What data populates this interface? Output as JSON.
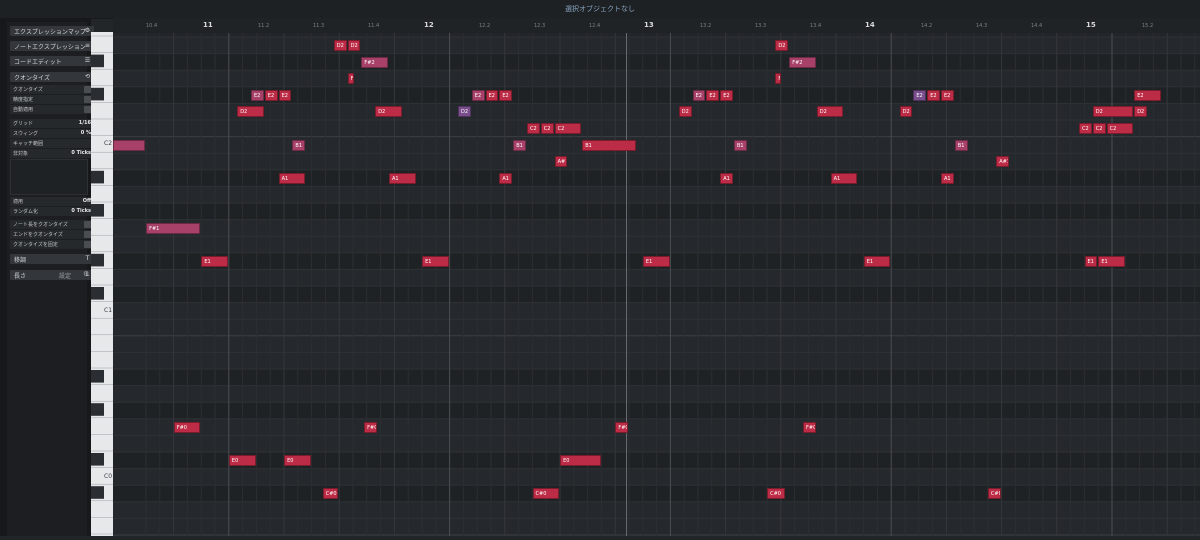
{
  "topbar": {
    "title": "選択オブジェクトなし"
  },
  "inspector": {
    "sections": [
      {
        "label": "エクスプレッションマップ"
      },
      {
        "label": "ノートエクスプレッション"
      },
      {
        "label": "コードエディット"
      },
      {
        "label": "クオンタイズ"
      }
    ],
    "quantize_rows": [
      {
        "label": "クオンタイズ",
        "value": ""
      },
      {
        "label": "精度指定",
        "value": ""
      },
      {
        "label": "自動適用",
        "value": ""
      },
      {
        "label": "グリッド",
        "value": "1/16"
      },
      {
        "label": "スウィング",
        "value": "0 %"
      },
      {
        "label": "キャッチ範囲",
        "value": ""
      },
      {
        "label": "非対象",
        "value": "0 Ticks"
      },
      {
        "label": "適用",
        "value": "Off"
      },
      {
        "label": "ランダム化",
        "value": "0 Ticks"
      },
      {
        "label": "ノート長をクオンタイズ",
        "value": ""
      },
      {
        "label": "エンドをクオンタイズ",
        "value": ""
      },
      {
        "label": "クオンタイズを固定",
        "value": ""
      }
    ],
    "bottom_sections": [
      {
        "label": "移調",
        "icon": "T"
      },
      {
        "label": "長さ",
        "icon": "L"
      }
    ],
    "settings_label": "設定"
  },
  "keyboard": {
    "labels": [
      "C2",
      "C1",
      "C0"
    ]
  },
  "ruler": {
    "bars": [
      "11",
      "12",
      "13",
      "14",
      "15"
    ],
    "beats": [
      "10.4",
      "11.2",
      "11.3",
      "11.4",
      "12.2",
      "12.3",
      "12.4",
      "13.2",
      "13.3",
      "13.4",
      "14.2",
      "14.3",
      "14.4",
      "15.2"
    ]
  },
  "colors": {
    "red": "#bd2c46",
    "magenta": "#a8416a",
    "purple": "#7a4e8c"
  },
  "notes": [
    {
      "label": "D2",
      "row": 0,
      "col": 16
    },
    {
      "label": "D2",
      "row": 0,
      "col": 17
    },
    {
      "label": "D2",
      "row": 0,
      "col": 48
    },
    {
      "label": "F#2",
      "row": 1,
      "col": 18,
      "len": 2,
      "color": "magenta"
    },
    {
      "label": "F#2",
      "row": 1,
      "col": 49,
      "len": 2,
      "color": "magenta"
    },
    {
      "label": "F2",
      "row": 2,
      "col": 17,
      "len": 0.5
    },
    {
      "label": "F2",
      "row": 2,
      "col": 48,
      "len": 0.5
    },
    {
      "label": "E2",
      "row": 3,
      "col": 10,
      "len": 1,
      "color": "magenta"
    },
    {
      "label": "E2",
      "row": 3,
      "col": 11
    },
    {
      "label": "E2",
      "row": 3,
      "col": 12
    },
    {
      "label": "E2",
      "row": 3,
      "col": 26,
      "len": 1,
      "color": "magenta"
    },
    {
      "label": "E2",
      "row": 3,
      "col": 27
    },
    {
      "label": "E2",
      "row": 3,
      "col": 28
    },
    {
      "label": "E2",
      "row": 3,
      "col": 42,
      "len": 1,
      "color": "magenta"
    },
    {
      "label": "E2",
      "row": 3,
      "col": 43
    },
    {
      "label": "E2",
      "row": 3,
      "col": 44
    },
    {
      "label": "E2",
      "row": 3,
      "col": 58,
      "len": 1,
      "color": "purple"
    },
    {
      "label": "E2",
      "row": 3,
      "col": 59
    },
    {
      "label": "E2",
      "row": 3,
      "col": 60
    },
    {
      "label": "E2",
      "row": 3,
      "col": 74,
      "len": 2
    },
    {
      "label": "D2",
      "row": 4,
      "col": 9,
      "len": 2
    },
    {
      "label": "D2",
      "row": 4,
      "col": 19,
      "len": 2
    },
    {
      "label": "D2",
      "row": 4,
      "col": 25,
      "len": 1,
      "color": "purple"
    },
    {
      "label": "D2",
      "row": 4,
      "col": 41
    },
    {
      "label": "D2",
      "row": 4,
      "col": 51,
      "len": 2
    },
    {
      "label": "D2",
      "row": 4,
      "col": 57
    },
    {
      "label": "D2",
      "row": 4,
      "col": 71,
      "len": 3
    },
    {
      "label": "D2",
      "row": 4,
      "col": 74
    },
    {
      "label": "D2",
      "row": 4,
      "col": 79
    },
    {
      "label": "D2",
      "row": 4,
      "col": 80
    },
    {
      "label": "D2",
      "row": 4,
      "col": 81,
      "len": 2
    },
    {
      "label": "C2",
      "row": 5,
      "col": 30
    },
    {
      "label": "C2",
      "row": 5,
      "col": 31
    },
    {
      "label": "C2",
      "row": 5,
      "col": 32,
      "len": 2
    },
    {
      "label": "C2",
      "row": 5,
      "col": 70
    },
    {
      "label": "C2",
      "row": 5,
      "col": 71
    },
    {
      "label": "C2",
      "row": 5,
      "col": 72,
      "len": 2
    },
    {
      "label": "",
      "row": 6,
      "col": 0,
      "len": 2.4,
      "color": "magenta"
    },
    {
      "label": "B1",
      "row": 6,
      "col": 13,
      "len": 1,
      "color": "magenta"
    },
    {
      "label": "B1",
      "row": 6,
      "col": 29,
      "len": 1,
      "color": "magenta"
    },
    {
      "label": "B1",
      "row": 6,
      "col": 34,
      "len": 4
    },
    {
      "label": "B1",
      "row": 6,
      "col": 45,
      "len": 1,
      "color": "magenta"
    },
    {
      "label": "B1",
      "row": 6,
      "col": 61,
      "len": 1,
      "color": "magenta"
    },
    {
      "label": "A#1",
      "row": 7,
      "col": 32,
      "len": 1
    },
    {
      "label": "A#1",
      "row": 7,
      "col": 64,
      "len": 1
    },
    {
      "label": "A1",
      "row": 8,
      "col": 12,
      "len": 2
    },
    {
      "label": "A1",
      "row": 8,
      "col": 20,
      "len": 2
    },
    {
      "label": "A1",
      "row": 8,
      "col": 28,
      "len": 1
    },
    {
      "label": "A1",
      "row": 8,
      "col": 44,
      "len": 1
    },
    {
      "label": "A1",
      "row": 8,
      "col": 52,
      "len": 2
    },
    {
      "label": "A1",
      "row": 8,
      "col": 60,
      "len": 1
    },
    {
      "label": "F#1",
      "row": 11,
      "col": 2.4,
      "len": 4,
      "color": "magenta"
    },
    {
      "label": "E1",
      "row": 13,
      "col": 6.4,
      "len": 2
    },
    {
      "label": "E1",
      "row": 13,
      "col": 22.4,
      "len": 2
    },
    {
      "label": "E1",
      "row": 13,
      "col": 38.4,
      "len": 2
    },
    {
      "label": "E1",
      "row": 13,
      "col": 54.4,
      "len": 2
    },
    {
      "label": "E1",
      "row": 13,
      "col": 70.4,
      "len": 1
    },
    {
      "label": "E1",
      "row": 13,
      "col": 71.4,
      "len": 2
    },
    {
      "label": "F#0",
      "row": 23,
      "col": 4.4,
      "len": 2
    },
    {
      "label": "F#0",
      "row": 23,
      "col": 18.2,
      "len": 1
    },
    {
      "label": "F#0",
      "row": 23,
      "col": 36.4,
      "len": 1
    },
    {
      "label": "F#0",
      "row": 23,
      "col": 50,
      "len": 1
    },
    {
      "label": "E0",
      "row": 25,
      "col": 8.4,
      "len": 2
    },
    {
      "label": "E0",
      "row": 25,
      "col": 12.4,
      "len": 2
    },
    {
      "label": "E0",
      "row": 25,
      "col": 32.4,
      "len": 3
    },
    {
      "label": "C#0",
      "row": 27,
      "col": 15.2,
      "len": 1.2
    },
    {
      "label": "C#0",
      "row": 27,
      "col": 30.4,
      "len": 2
    },
    {
      "label": "C#0",
      "row": 27,
      "col": 47.4,
      "len": 1.4
    },
    {
      "label": "C#0",
      "row": 27,
      "col": 63.4,
      "len": 1
    },
    {
      "label": "A#-1",
      "row": 30,
      "col": 10.4
    },
    {
      "label": "A#-1",
      "row": 30,
      "col": 11.4
    },
    {
      "label": "A#-1",
      "row": 30,
      "col": 14.4
    },
    {
      "label": "A#-1",
      "row": 30,
      "col": 26.4
    },
    {
      "label": "A#-1",
      "row": 30,
      "col": 27.4
    },
    {
      "label": "A#-1",
      "row": 30,
      "col": 30.4
    },
    {
      "label": "A#-1",
      "row": 30,
      "col": 31.4
    },
    {
      "label": "A#-1",
      "row": 30,
      "col": 42.4
    },
    {
      "label": "A#-1",
      "row": 30,
      "col": 43.4
    },
    {
      "label": "A#-1",
      "row": 30,
      "col": 46.4
    },
    {
      "label": "A#-1",
      "row": 30,
      "col": 58.4
    },
    {
      "label": "A#-1",
      "row": 30,
      "col": 59.4
    },
    {
      "label": "A#-1",
      "row": 30,
      "col": 62.4
    },
    {
      "label": "A#-1",
      "row": 30,
      "col": 63.4
    },
    {
      "label": "A#-1",
      "row": 30,
      "col": 75.4
    },
    {
      "label": "A-1",
      "row": 31,
      "col": 8.4,
      "len": 2
    }
  ]
}
